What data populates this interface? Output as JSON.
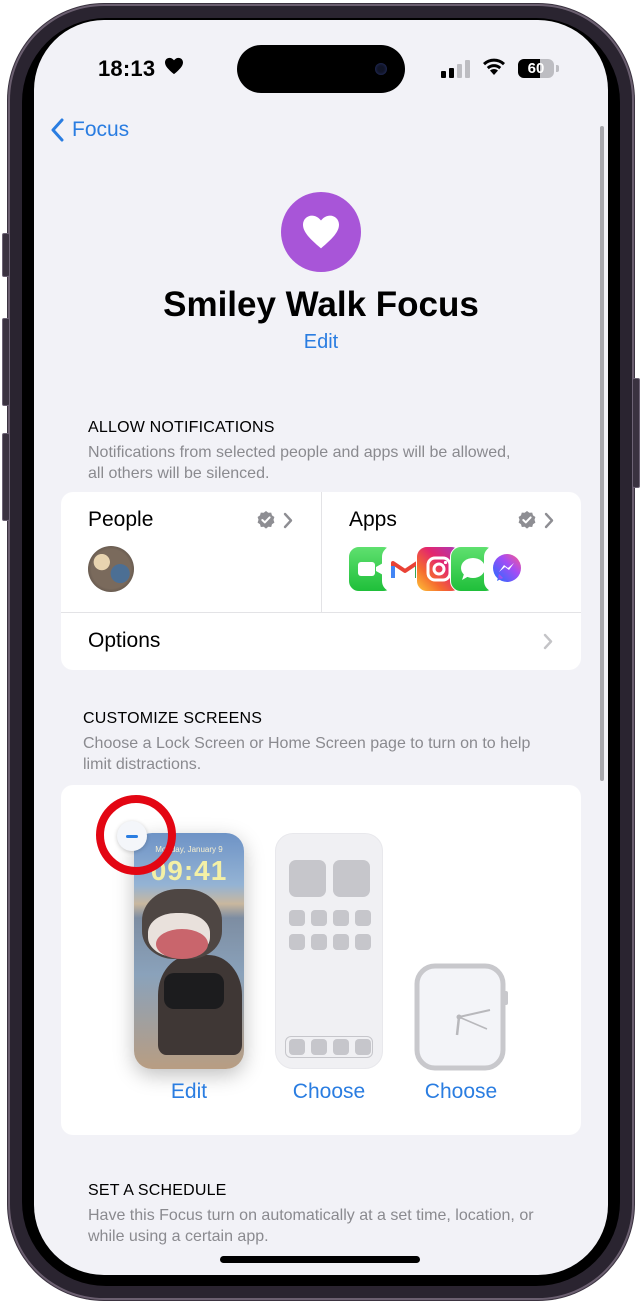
{
  "status_bar": {
    "time": "18:13",
    "focus_indicator": "heart-icon",
    "signal_bars_active": 2,
    "signal_bars_total": 4,
    "wifi": "wifi-icon",
    "battery_percent": "60"
  },
  "nav": {
    "back_label": "Focus"
  },
  "header": {
    "icon": "heart-icon",
    "icon_color": "#a855d8",
    "title": "Smiley Walk Focus",
    "edit_label": "Edit"
  },
  "allow_notifications": {
    "heading": "ALLOW NOTIFICATIONS",
    "description": "Notifications from selected people and apps will be allowed, all others will be silenced.",
    "people": {
      "label": "People",
      "badge": "checkmark-seal-icon",
      "avatars": [
        "contact-photo"
      ]
    },
    "apps": {
      "label": "Apps",
      "badge": "checkmark-seal-icon",
      "icons": [
        "facetime-app-icon",
        "gmail-app-icon",
        "instagram-app-icon",
        "messages-app-icon",
        "messenger-app-icon"
      ]
    },
    "options_label": "Options"
  },
  "customize_screens": {
    "heading": "CUSTOMIZE SCREENS",
    "description": "Choose a Lock Screen or Home Screen page to turn on to help limit distractions.",
    "lock_screen": {
      "date_text": "Monday, January 9",
      "time_text": "09:41",
      "action_label": "Edit"
    },
    "home_screen": {
      "action_label": "Choose"
    },
    "watch_face": {
      "action_label": "Choose"
    }
  },
  "schedule": {
    "heading": "SET A SCHEDULE",
    "description": "Have this Focus turn on automatically at a set time, location, or while using a certain app."
  },
  "colors": {
    "accent": "#2a7de1",
    "background": "#f2f2f7",
    "annotation_ring": "#e30613"
  }
}
